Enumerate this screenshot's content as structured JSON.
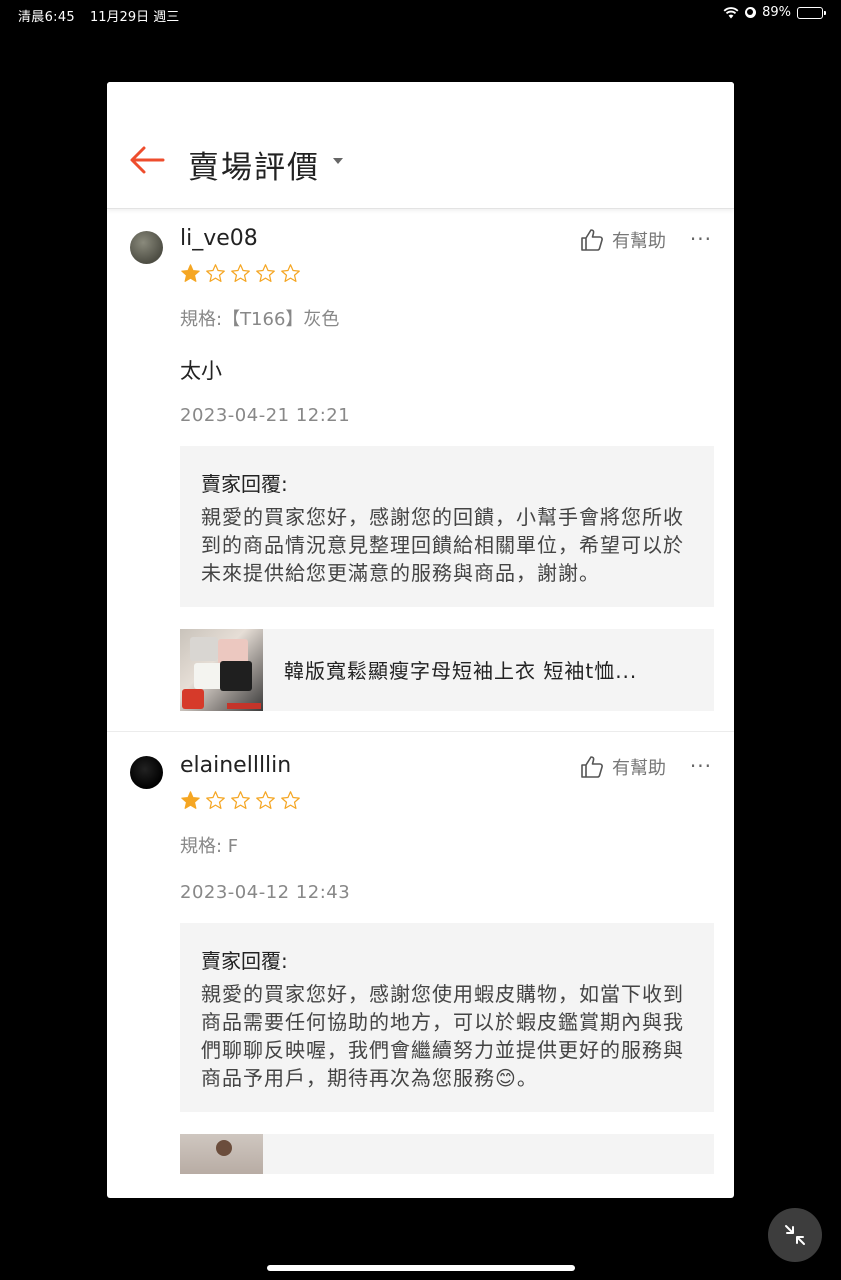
{
  "status_bar": {
    "time": "清晨6:45",
    "date": "11月29日 週三",
    "battery": "89%",
    "battery_level": 0.89
  },
  "header": {
    "title": "賣場評價"
  },
  "reviews": [
    {
      "username": "li_ve08",
      "helpful_label": "有幫助",
      "more": "···",
      "rating": 1,
      "max_rating": 5,
      "spec": "規格:【T166】灰色",
      "content": "太小",
      "date": "2023-04-21 12:21",
      "reply_title": "賣家回覆:",
      "reply_body": "親愛的買家您好，感謝您的回饋，小幫手會將您所收到的商品情況意見整理回饋給相關單位，希望可以於未來提供給您更滿意的服務與商品，謝謝。",
      "product_name": "韓版寬鬆顯瘦字母短袖上衣 短袖t恤..."
    },
    {
      "username": "elainellllin",
      "helpful_label": "有幫助",
      "more": "···",
      "rating": 1,
      "max_rating": 5,
      "spec": "規格: F",
      "date": "2023-04-12 12:43",
      "reply_title": "賣家回覆:",
      "reply_body": "親愛的買家您好，感謝您使用蝦皮購物，如當下收到商品需要任何協助的地方，可以於蝦皮鑑賞期內與我們聊聊反映喔，我們會繼續努力並提供更好的服務與商品予用戶，期待再次為您服務😊。"
    }
  ],
  "colors": {
    "accent": "#ee4d2d",
    "star": "#f5a623",
    "reply_bg": "#f4f4f4"
  }
}
